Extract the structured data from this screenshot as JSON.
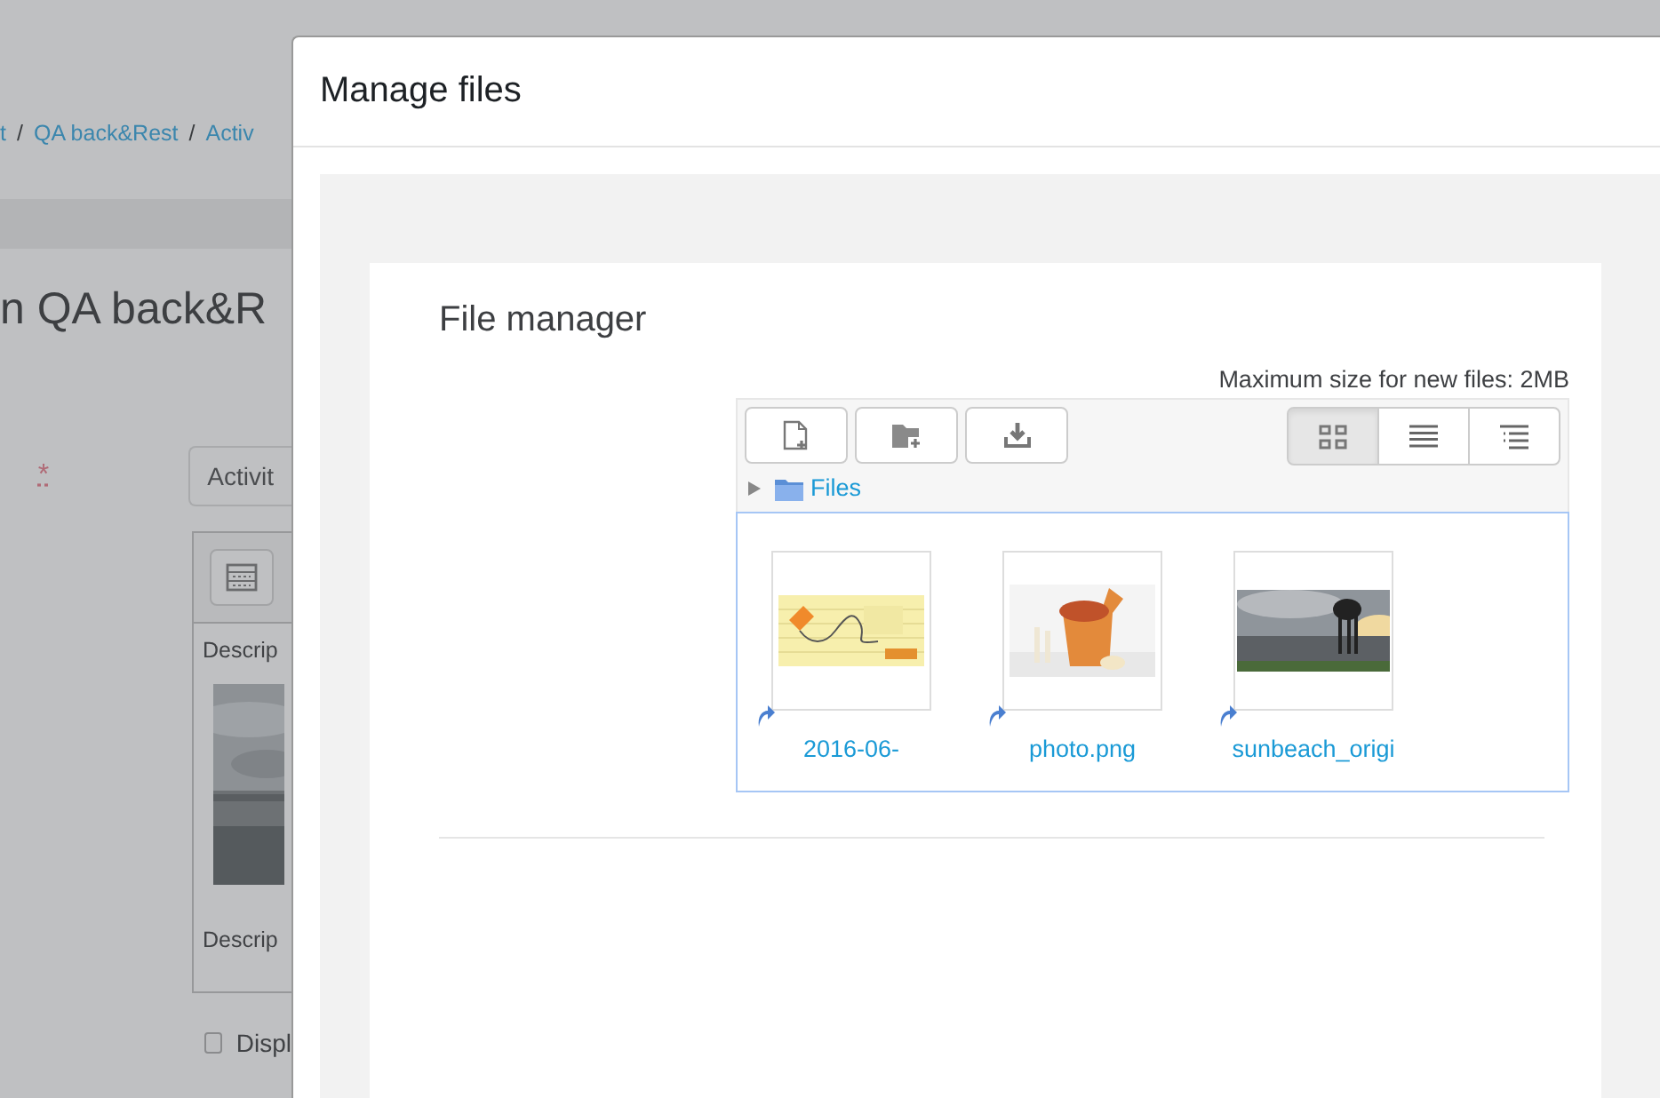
{
  "background_page": {
    "breadcrumb": [
      "t",
      "QA back&Rest",
      "Activ"
    ],
    "breadcrumb_separator": "/",
    "heading": "n QA back&R",
    "required_mark": "*",
    "name_field": {
      "value": "Activit"
    },
    "editor": {
      "texts": [
        "Descrip",
        "Descrip"
      ]
    },
    "display_checkbox": {
      "label": "Displ",
      "checked": false
    }
  },
  "dialog": {
    "title": "Manage files",
    "file_manager": {
      "title": "File manager",
      "max_size": "Maximum size for new files: 2MB",
      "view_modes": [
        {
          "kind": "icons",
          "selected": true
        },
        {
          "kind": "list",
          "selected": false
        },
        {
          "kind": "tree",
          "selected": false
        }
      ],
      "path": "Files",
      "files": [
        {
          "name": "2016-06-",
          "kind": "notes"
        },
        {
          "name": "photo.png",
          "kind": "food"
        },
        {
          "name": "sunbeach_origi",
          "kind": "beach"
        }
      ]
    }
  }
}
